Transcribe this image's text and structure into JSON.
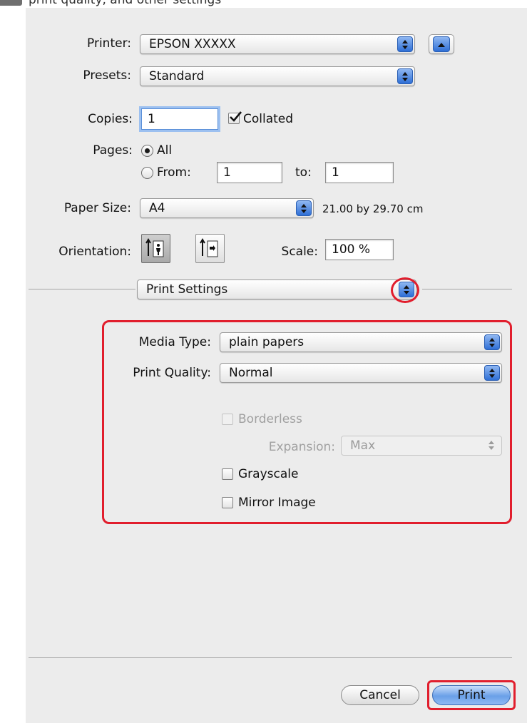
{
  "header": {
    "partial_text": "print quality, and other settings"
  },
  "printer": {
    "label": "Printer:",
    "value": "EPSON XXXXX"
  },
  "presets": {
    "label": "Presets:",
    "value": "Standard"
  },
  "copies": {
    "label": "Copies:",
    "value": "1",
    "collated_label": "Collated",
    "collated_checked": true
  },
  "pages": {
    "label": "Pages:",
    "all_label": "All",
    "from_label": "From:",
    "from_value": "1",
    "to_label": "to:",
    "to_value": "1",
    "selected": "All"
  },
  "paper_size": {
    "label": "Paper Size:",
    "value": "A4",
    "dimensions": "21.00 by 29.70 cm"
  },
  "orientation": {
    "label": "Orientation:",
    "selected": "portrait"
  },
  "scale": {
    "label": "Scale:",
    "value": "100 %"
  },
  "panel_menu": {
    "value": "Print Settings"
  },
  "print_settings": {
    "media_type_label": "Media Type:",
    "media_type_value": "plain papers",
    "print_quality_label": "Print Quality:",
    "print_quality_value": "Normal",
    "borderless_label": "Borderless",
    "expansion_label": "Expansion:",
    "expansion_value": "Max",
    "grayscale_label": "Grayscale",
    "mirror_label": "Mirror Image"
  },
  "buttons": {
    "cancel": "Cancel",
    "print": "Print"
  },
  "colors": {
    "highlight": "#e11e2d",
    "accent": "#3b78e0",
    "dialog_bg": "#ececec"
  },
  "icons": [
    "chevron-updown-icon",
    "disclosure-up-icon",
    "checkmark-icon",
    "portrait-orientation-icon",
    "landscape-orientation-icon"
  ]
}
